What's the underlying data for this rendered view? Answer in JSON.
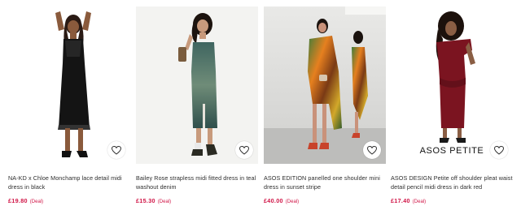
{
  "products": [
    {
      "title": "NA-KD x Chloe Monchamp lace detail midi dress in black",
      "price": "£19.80",
      "deal": "(Deal)",
      "image_icon": "product-photo"
    },
    {
      "title": "Bailey Rose strapless midi fitted dress in teal washout denim",
      "price": "£15.30",
      "deal": "(Deal)",
      "image_icon": "product-photo"
    },
    {
      "title": "ASOS EDITION panelled one shoulder mini dress in sunset stripe",
      "price": "£40.00",
      "deal": "(Deal)",
      "image_icon": "product-photo"
    },
    {
      "title": "ASOS DESIGN Petite off shoulder pleat waist detail pencil midi dress in dark red",
      "price": "£17.40",
      "deal": "(Deal)",
      "image_icon": "product-photo",
      "image_overlay": "ASOS PETITE"
    }
  ],
  "favourite_icon": "heart-outline-icon",
  "colors": {
    "price": "#d01345",
    "text": "#2d2d2d"
  }
}
